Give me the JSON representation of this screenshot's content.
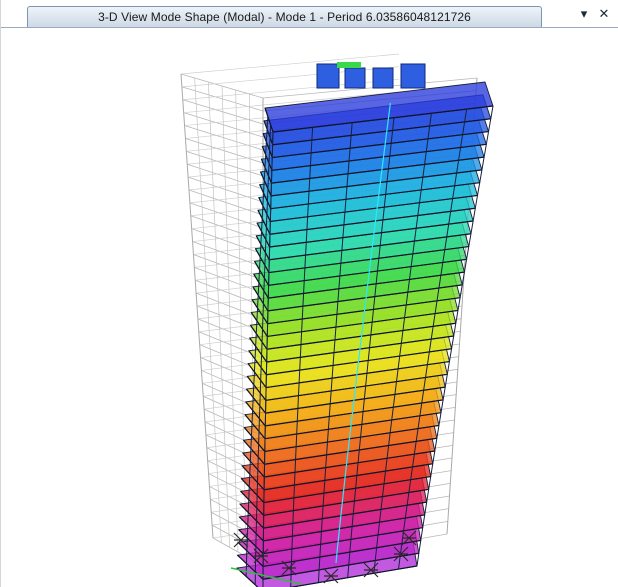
{
  "window": {
    "tab_title": "3-D View  Mode Shape (Modal) - Mode 1 - Period 6.03586048121726",
    "dropdown_icon": "chevron-down-icon",
    "close_icon": "close-icon"
  },
  "model": {
    "stories": 36,
    "mode": 1,
    "period": 6.03586048121726,
    "color_scale": [
      "#2a3bdc",
      "#1f6ee8",
      "#1cb8e0",
      "#2bd8b8",
      "#3ad84a",
      "#9be020",
      "#e8e81a",
      "#f3b012",
      "#ee6a1a",
      "#e5241e",
      "#d21e9e",
      "#b12ad8"
    ]
  }
}
